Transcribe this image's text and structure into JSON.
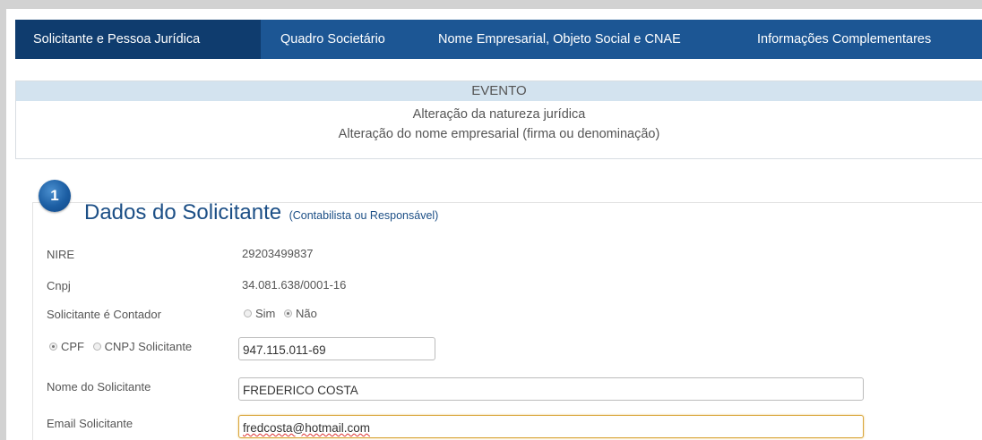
{
  "tabs": [
    {
      "label": "Solicitante e Pessoa Jurídica",
      "active": true
    },
    {
      "label": "Quadro Societário",
      "active": false
    },
    {
      "label": "Nome Empresarial, Objeto Social e CNAE",
      "active": false
    },
    {
      "label": "Informações Complementares",
      "active": false
    }
  ],
  "evento": {
    "header": "EVENTO",
    "lines": [
      "Alteração da natureza jurídica",
      "Alteração do nome empresarial (firma ou denominação)"
    ]
  },
  "section": {
    "number": "1",
    "title": "Dados do Solicitante",
    "subtitle": "(Contabilista ou Responsável)"
  },
  "fields": {
    "nire_label": "NIRE",
    "nire_value": "29203499837",
    "cnpj_label": "Cnpj",
    "cnpj_value": "34.081.638/0001-16",
    "contador_label": "Solicitante é Contador",
    "contador_options": [
      "Sim",
      "Não"
    ],
    "contador_selected": "Não",
    "doc_options": [
      "CPF",
      "CNPJ Solicitante"
    ],
    "doc_selected": "CPF",
    "doc_value": "947.115.011-69",
    "nome_label": "Nome do Solicitante",
    "nome_value": "FREDERICO COSTA",
    "email_label": "Email Solicitante",
    "email_value": "fredcosta@hotmail.com"
  },
  "colors": {
    "nav_bg": "#1c5694",
    "nav_active_bg": "#0f3c6e",
    "evento_header_bg": "#d3e3ef",
    "title_blue": "#1c4f86",
    "focus_border": "#d9a63a"
  }
}
